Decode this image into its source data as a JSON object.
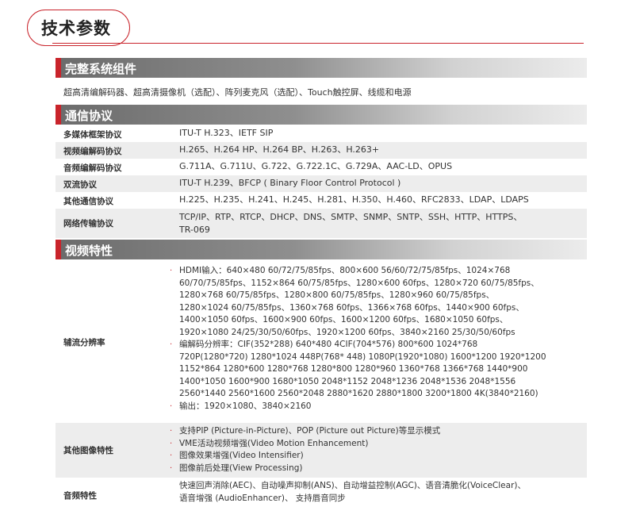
{
  "page_title": "技术参数",
  "sections": {
    "system": {
      "title": "完整系统组件",
      "text": "超高清编解码器、超高清摄像机（选配）、阵列麦克风（选配）、Touch触控屏、线缆和电源"
    },
    "protocol": {
      "title": "通信协议",
      "rows": [
        {
          "key": "多媒体框架协议",
          "lines": [
            "ITU-T H.323、IETF SIP"
          ]
        },
        {
          "key": "视频编解码协议",
          "lines": [
            "H.265、H.264 HP、H.264 BP、H.263、H.263+"
          ]
        },
        {
          "key": "音频编解码协议",
          "lines": [
            "G.711A、G.711U、G.722、G.722.1C、G.729A、AAC-LD、OPUS"
          ]
        },
        {
          "key": "双流协议",
          "lines": [
            "ITU-T H.239、BFCP ( Binary Floor Control Protocol )"
          ]
        },
        {
          "key": "其他通信协议",
          "lines": [
            "H.225、H.235、H.241、H.245、H.281、H.350、H.460、RFC2833、LDAP、LDAPS"
          ]
        },
        {
          "key": "网络传输协议",
          "lines": [
            "TCP/IP、RTP、RTCP、DHCP、DNS、SMTP、SNMP、SNTP、SSH、HTTP、HTTPS、",
            "TR-069"
          ]
        }
      ]
    },
    "video": {
      "title": "视频特性",
      "aux": {
        "key": "辅流分辨率",
        "bullets": [
          {
            "lines": [
              "HDMI输入：640×480 60/72/75/85fps、800×600 56/60/72/75/85fps、1024×768",
              "60/70/75/85fps、1152×864 60/75/85fps、1280×600 60fps、1280×720 60/75/85fps、",
              "1280×768  60/75/85fps、1280×800 60/75/85fps、1280×960 60/75/85fps、",
              "1280×1024 60/75/85fps、1360×768 60fps、1366×768  60fps、1440×900 60fps、",
              "1400×1050 60fps、1600×900 60fps、1600×1200 60fps、1680×1050  60fps、",
              "1920×1080 24/25/30/50/60fps、1920×1200 60fps、3840×2160 25/30/50/60fps"
            ]
          },
          {
            "lines": [
              "编解码分辨率：CIF(352*288) 640*480 4CIF(704*576) 800*600 1024*768",
              "720P(1280*720) 1280*1024 448P(768* 448) 1080P(1920*1080) 1600*1200 1920*1200",
              "1152*864 1280*600 1280*768 1280*800 1280*960 1360*768 1366*768 1440*900",
              "1400*1050 1600*900 1680*1050 2048*1152 2048*1236 2048*1536 2048*1556",
              "2560*1440 2560*1600 2560*2048 2880*1620 2880*1800 3200*1800 4K(3840*2160)"
            ]
          },
          {
            "lines": [
              "输出：1920×1080、3840×2160"
            ]
          }
        ]
      },
      "other": {
        "key": "其他图像特性",
        "bullets": [
          {
            "lines": [
              "支持PIP (Picture-in-Picture)、POP (Picture out Picture)等显示模式"
            ]
          },
          {
            "lines": [
              "VME活动视频增强(Video Motion Enhancement)"
            ]
          },
          {
            "lines": [
              "图像效果增强(Video Intensifier)"
            ]
          },
          {
            "lines": [
              "图像前后处理(View Processing)"
            ]
          }
        ]
      },
      "audio": {
        "key": "音频特性",
        "lines": [
          "快速回声消除(AEC)、自动噪声抑制(ANS)、自动增益控制(AGC)、语音清脆化(VoiceClear)、",
          "语音增强 (AudioEnhancer)、 支持唇音同步"
        ]
      }
    }
  },
  "colors": {
    "accent": "#c9242b",
    "row_shade": "#ededed",
    "header_dark": "#6b6b6b"
  }
}
